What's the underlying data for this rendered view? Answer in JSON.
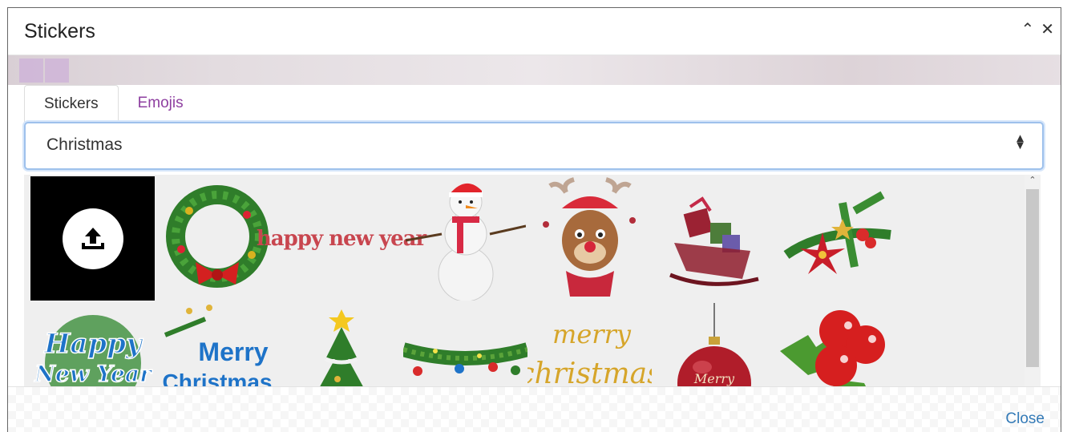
{
  "modal": {
    "title": "Stickers",
    "collapse_icon": "double-chevron-up-icon",
    "close_icon": "close-icon"
  },
  "tabs": [
    {
      "label": "Stickers",
      "active": true
    },
    {
      "label": "Emojis",
      "active": false
    }
  ],
  "category_select": {
    "value": "Christmas"
  },
  "stickers": {
    "upload_icon": "upload-icon",
    "items": [
      {
        "name": "wreath"
      },
      {
        "name": "happy-new-year-text",
        "text": "happy new year"
      },
      {
        "name": "snowman"
      },
      {
        "name": "reindeer"
      },
      {
        "name": "sleigh"
      },
      {
        "name": "poinsettia"
      },
      {
        "name": "happy-new-year-badge",
        "text_line1": "Happy",
        "text_line2": "New Year"
      },
      {
        "name": "merry-christmas-text",
        "text_line1": "Merry",
        "text_line2": "Christmas"
      },
      {
        "name": "christmas-tree"
      },
      {
        "name": "garland"
      },
      {
        "name": "merry-christmas-gold",
        "text_line1": "merry",
        "text_line2": "christmas"
      },
      {
        "name": "ornament-ball",
        "text": "Merry"
      },
      {
        "name": "holly-berries"
      }
    ]
  },
  "footer": {
    "close_label": "Close"
  },
  "colors": {
    "accent": "#337ab7",
    "tab_inactive": "#8e3fa0",
    "select_border": "#9ec1ec"
  }
}
